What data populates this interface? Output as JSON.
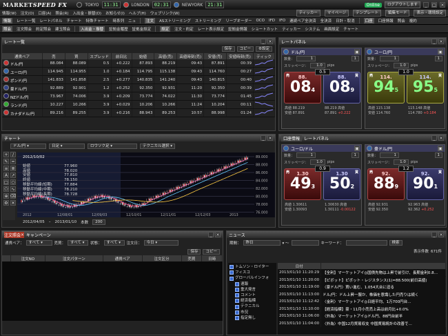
{
  "app": {
    "logo_main": "MARKET",
    "logo_sub": "SPEED FX",
    "clocks": [
      {
        "city": "TOKYO",
        "time": "11:31"
      },
      {
        "city": "LONDON",
        "time": "02:31"
      },
      {
        "city": "NEWYORK",
        "time": "21:31"
      }
    ],
    "online": "Online",
    "login_time": "ログアウトします",
    "right_btns": [
      "ティッカー",
      "マイページ",
      "テンプレート",
      "編集モード",
      "表示・環境設定"
    ]
  },
  "menu1": [
    "情報(W)",
    "注文(O)",
    "口座(A)",
    "照会(R)",
    "入出金・振替(D)",
    "お知らせ(I)",
    "ヘルプ(H)",
    "ウェブリンク(W)"
  ],
  "menu2": [
    "情報",
    "レート一覧",
    "レートパネル",
    "チャート",
    "特殊チャート",
    "時系列",
    "ニュ",
    "注文",
    "ASストリーミング",
    "ストリーミング",
    "リーブオーダー",
    "OCO",
    "IFD",
    "IFO",
    "逆指値",
    "口座",
    "口座情報",
    "照会",
    "複約"
  ],
  "menu2b": [
    "連続ペア全決済",
    "全決済",
    "日計・取消",
    "注文・約定",
    "レート表示設定",
    "証拠金情報",
    "ショートカット",
    "ティッカー",
    "システム",
    "画面設定",
    "チャート"
  ],
  "menu3": [
    "照会",
    "注文照会",
    "約定照会",
    "建玉照会",
    "入出金・振替",
    "証拠金履歴",
    "証拠金設定",
    "設定"
  ],
  "rates": {
    "title": "レート一覧",
    "save": "保存",
    "copy": "コピー",
    "settings": "設定",
    "headers": [
      "通貨ペア",
      "売",
      "買",
      "スプレッド",
      "前日比",
      "始値",
      "高値(売)",
      "高値時刻(売)",
      "安値(売)",
      "安値時刻(売)",
      "ティック"
    ],
    "rows": [
      [
        "ドル/円",
        "88.084",
        "88.089",
        "0.5",
        "+0.222",
        "87.893",
        "88.219",
        "09:43",
        "87.891",
        "00:39",
        "up"
      ],
      [
        "ユーロ/円",
        "114.945",
        "114.955",
        "1.0",
        "+0.184",
        "114.795",
        "115.138",
        "09:43",
        "114.760",
        "00:27",
        "up"
      ],
      [
        "ポンド/円",
        "141.833",
        "141.858",
        "2.5",
        "+0.277",
        "140.835",
        "141.240",
        "09:43",
        "140.815",
        "00:40",
        "up"
      ],
      [
        "豪ドル/円",
        "92.889",
        "92.901",
        "1.2",
        "+0.252",
        "92.350",
        "92.931",
        "11:20",
        "92.350",
        "00:39",
        "up"
      ],
      [
        "NZドル/円",
        "73.967",
        "74.006",
        "3.9",
        "+0.209",
        "73.774",
        "74.022",
        "11:30",
        "73.774",
        "01:45",
        "up"
      ],
      [
        "ランド/円",
        "10.227",
        "10.266",
        "3.9",
        "+0.029",
        "10.206",
        "10.266",
        "11:24",
        "10.204",
        "00:11",
        "dn"
      ],
      [
        "カナダドル/円",
        "89.216",
        "89.255",
        "3.9",
        "+0.216",
        "88.943",
        "89.253",
        "10:57",
        "88.998",
        "01:24",
        "up"
      ]
    ]
  },
  "rp1": {
    "title": "レートパネル",
    "cards": [
      {
        "pair": "ドル/円",
        "qty_label": "数量：",
        "qty": "1",
        "slip_label": "スリッページ：",
        "slip": "1.0",
        "unit": "pips",
        "sell_top": "88.",
        "sell_big": "08",
        "sell_sm": "4",
        "buy_top": "88.",
        "buy_big": "08",
        "buy_sm": "9",
        "spread": "0.5",
        "sell": "売",
        "buy": "買",
        "hi": "高値",
        "lo": "安値",
        "hi_v": "88.219",
        "lo_v": "87.891",
        "hi_v2": "88.219",
        "lo_v2": "87.891",
        "chg_label": "前日比",
        "chg": "+0.222",
        "chgb": "+0.222"
      },
      {
        "pair": "ユーロ/円",
        "qty_label": "数量：",
        "qty": "1",
        "slip_label": "スリッページ：",
        "slip": "1.0",
        "unit": "pips",
        "sell_top": "114.",
        "sell_big": "94",
        "sell_sm": "5",
        "buy_top": "114.",
        "buy_big": "95",
        "buy_sm": "5",
        "spread": "1.0",
        "sell": "売",
        "buy": "買",
        "hi": "高値",
        "lo": "安値",
        "hi_v": "115.138",
        "lo_v": "114.760",
        "hi_v2": "115.148",
        "lo_v2": "114.780",
        "chg_label": "前日比",
        "chg": "+0.184",
        "chgb": "+0.184"
      }
    ]
  },
  "rp2": {
    "title": "レートパネル",
    "account": "口座情報",
    "cards": [
      {
        "pair": "ユーロ/ドル",
        "qty_label": "数量：",
        "qty": "1",
        "slip_label": "スリッページ：",
        "slip": "1.0",
        "unit": "pips",
        "sell_top": "1.30",
        "sell_big": "49",
        "sell_sm": "3",
        "buy_top": "1.30",
        "buy_big": "50",
        "buy_sm": "2",
        "spread": "0.9",
        "sell": "売",
        "buy": "買",
        "hi": "高値",
        "lo": "安値",
        "hi_v": "1.30611",
        "lo_v": "1.30093",
        "hi_v2": "1.30630",
        "lo_v2": "1.30111",
        "chg_label": "前日比",
        "chg": "-0.00122",
        "chgb": "-0.00122"
      },
      {
        "pair": "豪ドル/円",
        "qty_label": "数量：",
        "qty": "1",
        "slip_label": "スリッページ：",
        "slip": "1.0",
        "unit": "pips",
        "sell_top": "92.",
        "sell_big": "88",
        "sell_sm": "9",
        "buy_top": "92.",
        "buy_big": "90",
        "buy_sm": "1",
        "spread": "1.2",
        "sell": "売",
        "buy": "買",
        "hi": "高値",
        "lo": "安値",
        "hi_v": "92.931",
        "lo_v": "92.350",
        "hi_v2": "92.963",
        "lo_v2": "92.362",
        "chg_label": "前日比",
        "chg": "+0.252",
        "chgb": "+0.252"
      }
    ]
  },
  "chart": {
    "title": "チャート",
    "pair": "ドル/円",
    "period": "日足",
    "type": "ロウソク足",
    "tech": "テクニカル選択",
    "date": "2012/10/02",
    "range_from": "2012/04/05",
    "range_to": "2013/01/10",
    "count_label": "本数",
    "count": "200",
    "legend": [
      [
        "始値",
        "77.960"
      ],
      [
        "高値",
        "78.020"
      ],
      [
        "安値",
        "77.810"
      ],
      [
        "終値",
        "78.150"
      ],
      [
        "移動平均線(短期)",
        "77.884"
      ],
      [
        "移動平均線(中期)",
        "78.210"
      ],
      [
        "移動平均線(長期)",
        "78.728"
      ]
    ],
    "yticks": [
      "89.000",
      "88.000",
      "86.000",
      "84.000",
      "82.000",
      "80.000",
      "78.000",
      "76.000"
    ],
    "xticks": [
      "2012",
      "12/08/01",
      "12/09/03",
      "12/10/01",
      "12/11/01",
      "12/12/03",
      "2013"
    ]
  },
  "orders": {
    "tab1": "注文照会",
    "tab2": "キャンペーン",
    "pair_label": "通貨ペア：",
    "pair": "すべて",
    "side_label": "売買：",
    "side": "すべて",
    "status_label": "状態：",
    "status": "すべて",
    "date_label": "注文日：",
    "date": "今日",
    "save": "保存",
    "copy": "コピー",
    "headers": [
      "注文NO",
      "注文パターン",
      "通貨ペア",
      "注文区分",
      "売買",
      "日時"
    ]
  },
  "news": {
    "title": "ニュース",
    "period_label": "期間：",
    "period": "昨日",
    "keyword_label": "キーワード：",
    "search": "検索",
    "count_label": "表示件数",
    "count": "671件",
    "sources": [
      "トムソン・ロイター",
      "フィスコ",
      "グローバルインフォ"
    ],
    "cats": [
      "速報",
      "重大発言",
      "コメント",
      "経済指標",
      "テクニカル",
      "市況",
      "指定無し"
    ],
    "date_header": "日付",
    "items": [
      [
        "2013/01/10 11:20:29",
        "【全利】マーケットアイ◎国債先物は上昇で前引け、長期金利0.8…"
      ],
      [
        "2013/01/10 11:20:00",
        "【ピボット】ピボット・レジスタンス(1)=88.500(前日高値)"
      ],
      [
        "2013/01/10 11:19:00",
        "〈豪ドル円〉買い進む、1.054大台に迫る"
      ],
      [
        "2013/01/10 11:13:00",
        "ドル/円：ドル上昇一服か、株価を意識した円売りは続く"
      ],
      [
        "2013/01/10 11:12:42",
        "〈金利〉マーケットアイ◎日経平均、1万700円台…"
      ],
      [
        "2013/01/10 11:10:00",
        "【経済指標】豪・11月小売売上高は前月比+0.0%"
      ],
      [
        "2013/01/10 11:06:00",
        "〈外為〉マーケットアイ◎ドル円、88円台前半"
      ],
      [
        "2013/01/10 11:04:00",
        "〈外為〉中国12月貿易収支 中国貿易統計の改善で…"
      ]
    ]
  }
}
